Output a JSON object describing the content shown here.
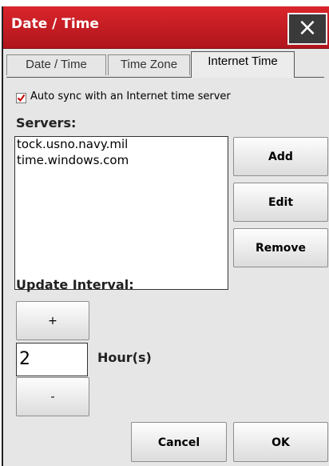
{
  "window": {
    "title": "Date / Time",
    "close_glyph": "×"
  },
  "tabs": [
    {
      "label": "Date / Time",
      "active": false
    },
    {
      "label": "Time Zone",
      "active": false
    },
    {
      "label": "Internet Time",
      "active": true
    }
  ],
  "auto_sync": {
    "label": "Auto sync with an Internet time server",
    "checked": true,
    "check_color": "#cc0000"
  },
  "servers": {
    "label": "Servers:",
    "items": [
      "tock.usno.navy.mil",
      "time.windows.com"
    ]
  },
  "server_buttons": {
    "add": "Add",
    "edit": "Edit",
    "remove": "Remove"
  },
  "update_interval": {
    "label": "Update Interval:",
    "increment_label": "+",
    "decrement_label": "-",
    "value": "2",
    "unit": "Hour(s)"
  },
  "footer": {
    "cancel": "Cancel",
    "ok": "OK"
  },
  "colors": {
    "titlebar": "#c71d23",
    "dialog_bg": "#e6e6e6"
  }
}
